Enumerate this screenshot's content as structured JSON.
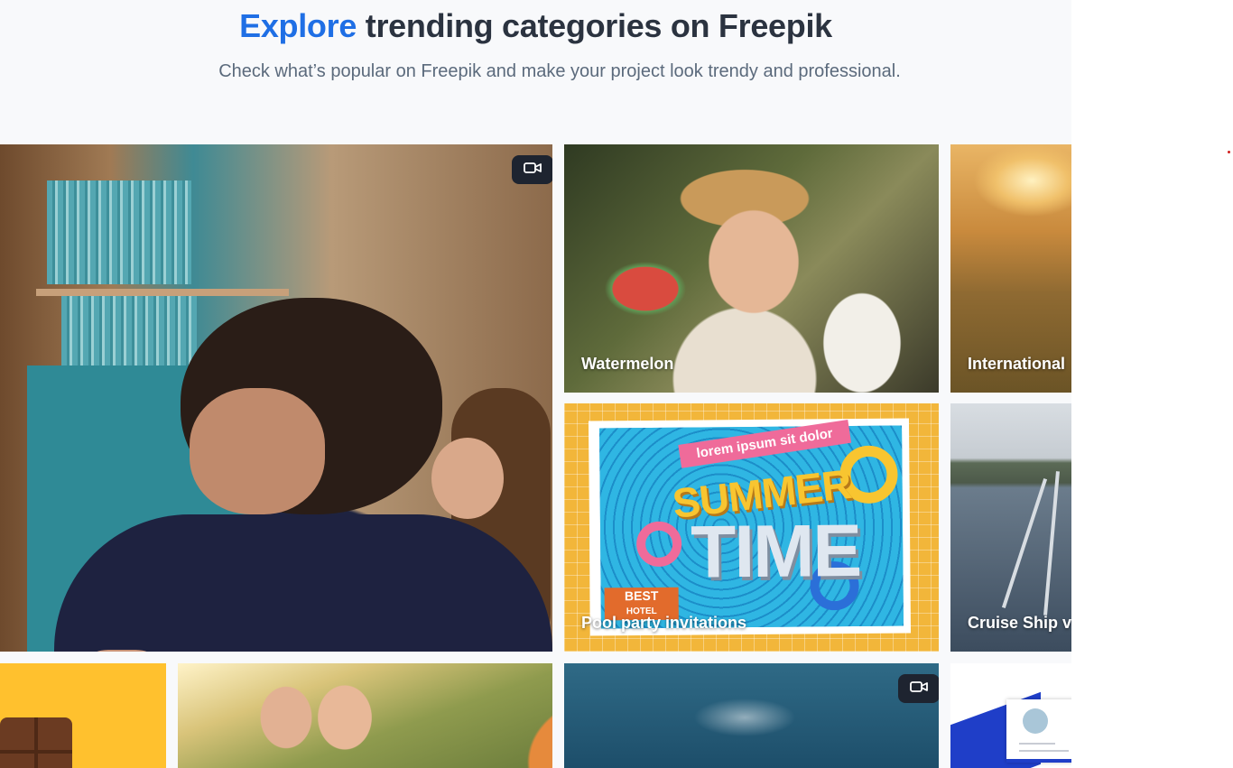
{
  "section": {
    "heading_accent": "Explore",
    "heading_rest": "trending categories on Freepik",
    "subheading": "Check what’s popular on Freepik and make your project look trendy and professional."
  },
  "tiles": [
    {
      "label": "",
      "video": true,
      "icon": "video-camera-icon"
    },
    {
      "label": "Watermelon",
      "video": false
    },
    {
      "label": "International",
      "video": false
    },
    {
      "label": "Pool party invitations",
      "video": false
    },
    {
      "label": "Cruise Ship v",
      "video": false
    },
    {
      "label": "",
      "video": false
    },
    {
      "label": "",
      "video": false
    },
    {
      "label": "",
      "video": true,
      "icon": "video-camera-icon"
    },
    {
      "label": "",
      "video": false
    }
  ],
  "pool_artwork": {
    "banner": "lorem ipsum sit dolor",
    "title_1": "SUMMER",
    "title_2": "TIME",
    "badge_1": "BEST",
    "badge_2": "HOTEL"
  },
  "colors": {
    "accent": "#1f6fe5",
    "heading": "#2b3340",
    "subheading": "#5b6a7c",
    "background": "#f8f9fb"
  }
}
